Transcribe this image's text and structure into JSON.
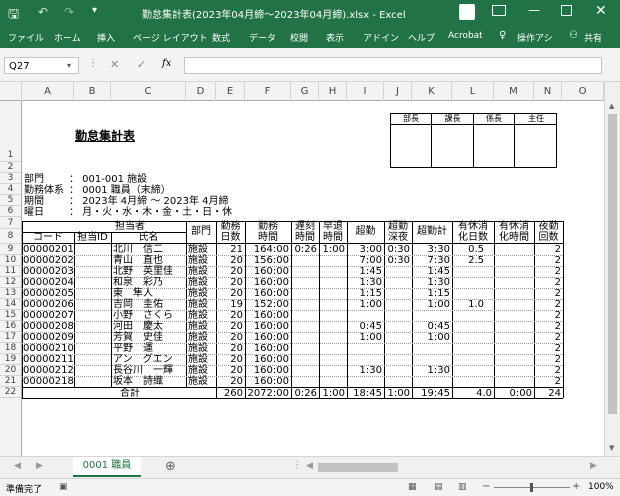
{
  "window": {
    "title": "勤怠集計表(2023年04月締～2023年04月締).xlsx - Excel",
    "save_icon": "save-icon",
    "undo_icon": "undo-icon",
    "redo_icon": "redo-icon"
  },
  "ribbon": {
    "tabs": [
      "ファイル",
      "ホーム",
      "挿入",
      "ページ レイアウト",
      "数式",
      "データ",
      "校閲",
      "表示",
      "アドイン",
      "ヘルプ",
      "Acrobat"
    ],
    "tell_me": "操作アシ",
    "share": "共有"
  },
  "formula": {
    "name_box": "Q27",
    "fx": "fx",
    "value": ""
  },
  "columns": [
    "A",
    "B",
    "C",
    "D",
    "E",
    "F",
    "G",
    "H",
    "I",
    "J",
    "K",
    "L",
    "M",
    "N",
    "O"
  ],
  "rows": [
    "1",
    "2",
    "3",
    "4",
    "5",
    "6",
    "7",
    "8",
    "9",
    "10",
    "11",
    "12",
    "13",
    "14",
    "15",
    "16",
    "17",
    "18",
    "19",
    "20",
    "21",
    "22"
  ],
  "sheet": {
    "title": "勤怠集計表",
    "approval": [
      "部長",
      "課長",
      "係長",
      "主任"
    ],
    "info": [
      {
        "label": "部門",
        "value": "： 001-001 施設"
      },
      {
        "label": "勤務体系",
        "value": "： 0001 職員（末締）"
      },
      {
        "label": "期間",
        "value": "： 2023年 4月締 ～ 2023年 4月締"
      },
      {
        "label": "曜日",
        "value": "： 月・火・水・木・金・土・日・休"
      }
    ],
    "headers": {
      "tanto": "担当者",
      "code": "コード",
      "tanto_id": "担当ID",
      "name": "氏名",
      "bumon": "部門",
      "kinmu_nissu": [
        "勤務",
        "日数"
      ],
      "kinmu_jikan": [
        "勤務",
        "時間"
      ],
      "chikoku": [
        "遅刻",
        "時間"
      ],
      "soutai": [
        "早退",
        "時間"
      ],
      "zangyo": "超勤",
      "shinya": [
        "超勤",
        "深夜"
      ],
      "gokei": "超勤計",
      "yukyu_nissu": [
        "有休消",
        "化日数"
      ],
      "yukyu_jikan": [
        "有休消",
        "化時間"
      ],
      "yakin": [
        "夜勤",
        "回数"
      ]
    },
    "records": [
      {
        "code": "00000201",
        "name": "北川　信二",
        "dept": "施設",
        "days": "21",
        "hours": "164:00",
        "late": "0:26",
        "early": "1:00",
        "ot": "3:00",
        "night": "0:30",
        "ot_total": "3:30",
        "pl_days": "0.5",
        "pl_hours": "",
        "yakin": "2"
      },
      {
        "code": "00000202",
        "name": "青山　直也",
        "dept": "施設",
        "days": "20",
        "hours": "156:00",
        "late": "",
        "early": "",
        "ot": "7:00",
        "night": "0:30",
        "ot_total": "7:30",
        "pl_days": "2.5",
        "pl_hours": "",
        "yakin": "2"
      },
      {
        "code": "00000203",
        "name": "北野　英里佳",
        "dept": "施設",
        "days": "20",
        "hours": "160:00",
        "late": "",
        "early": "",
        "ot": "1:45",
        "night": "",
        "ot_total": "1:45",
        "pl_days": "",
        "pl_hours": "",
        "yakin": "2"
      },
      {
        "code": "00000204",
        "name": "和泉　彩乃",
        "dept": "施設",
        "days": "20",
        "hours": "160:00",
        "late": "",
        "early": "",
        "ot": "1:30",
        "night": "",
        "ot_total": "1:30",
        "pl_days": "",
        "pl_hours": "",
        "yakin": "2"
      },
      {
        "code": "00000205",
        "name": "東　隼人",
        "dept": "施設",
        "days": "20",
        "hours": "160:00",
        "late": "",
        "early": "",
        "ot": "1:15",
        "night": "",
        "ot_total": "1:15",
        "pl_days": "",
        "pl_hours": "",
        "yakin": "2"
      },
      {
        "code": "00000206",
        "name": "吉岡　圭佑",
        "dept": "施設",
        "days": "19",
        "hours": "152:00",
        "late": "",
        "early": "",
        "ot": "1:00",
        "night": "",
        "ot_total": "1:00",
        "pl_days": "1.0",
        "pl_hours": "",
        "yakin": "2"
      },
      {
        "code": "00000207",
        "name": "小野　さくら",
        "dept": "施設",
        "days": "20",
        "hours": "160:00",
        "late": "",
        "early": "",
        "ot": "",
        "night": "",
        "ot_total": "",
        "pl_days": "",
        "pl_hours": "",
        "yakin": "2"
      },
      {
        "code": "00000208",
        "name": "河田　慶太",
        "dept": "施設",
        "days": "20",
        "hours": "160:00",
        "late": "",
        "early": "",
        "ot": "0:45",
        "night": "",
        "ot_total": "0:45",
        "pl_days": "",
        "pl_hours": "",
        "yakin": "2"
      },
      {
        "code": "00000209",
        "name": "芳賀　史佳",
        "dept": "施設",
        "days": "20",
        "hours": "160:00",
        "late": "",
        "early": "",
        "ot": "1:00",
        "night": "",
        "ot_total": "1:00",
        "pl_days": "",
        "pl_hours": "",
        "yakin": "2"
      },
      {
        "code": "00000210",
        "name": "平野　運",
        "dept": "施設",
        "days": "20",
        "hours": "160:00",
        "late": "",
        "early": "",
        "ot": "",
        "night": "",
        "ot_total": "",
        "pl_days": "",
        "pl_hours": "",
        "yakin": "2"
      },
      {
        "code": "00000211",
        "name": "アン　グエン",
        "dept": "施設",
        "days": "20",
        "hours": "160:00",
        "late": "",
        "early": "",
        "ot": "",
        "night": "",
        "ot_total": "",
        "pl_days": "",
        "pl_hours": "",
        "yakin": "2"
      },
      {
        "code": "00000212",
        "name": "長谷川　一輝",
        "dept": "施設",
        "days": "20",
        "hours": "160:00",
        "late": "",
        "early": "",
        "ot": "1:30",
        "night": "",
        "ot_total": "1:30",
        "pl_days": "",
        "pl_hours": "",
        "yakin": "2"
      },
      {
        "code": "00000218",
        "name": "坂本　詩織",
        "dept": "施設",
        "days": "20",
        "hours": "160:00",
        "late": "",
        "early": "",
        "ot": "",
        "night": "",
        "ot_total": "",
        "pl_days": "",
        "pl_hours": "",
        "yakin": "2"
      }
    ],
    "total": {
      "label": "合計",
      "days": "260",
      "hours": "2072:00",
      "late": "0:26",
      "early": "1:00",
      "ot": "18:45",
      "night": "1:00",
      "ot_total": "19:45",
      "pl_days": "4.0",
      "pl_hours": "0:00",
      "yakin": "24"
    }
  },
  "tabs": {
    "active": "0001 職員",
    "add": "⊕"
  },
  "status": {
    "ready": "準備完了",
    "zoom": "100%"
  }
}
